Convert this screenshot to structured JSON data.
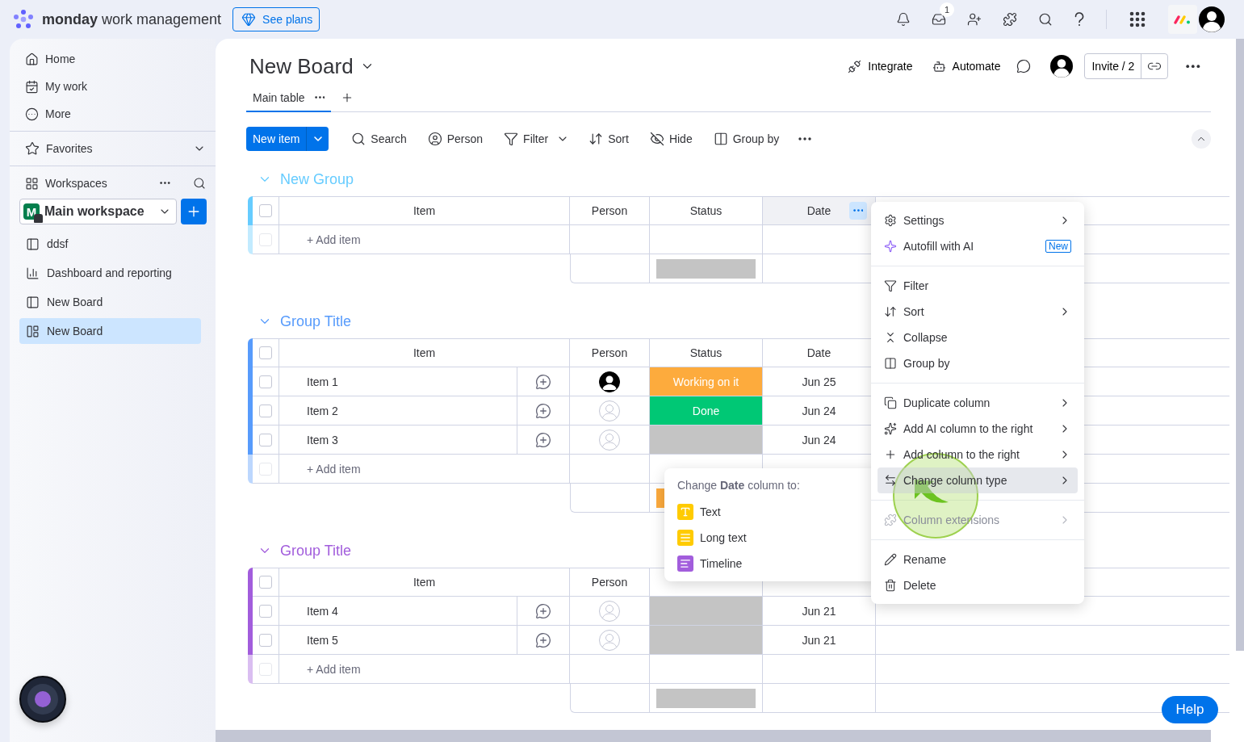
{
  "topbar": {
    "brand": "**monday** work management",
    "see_plans": "See plans",
    "inbox_badge": "1"
  },
  "sidebar": {
    "nav": [
      "Home",
      "My work",
      "More"
    ],
    "favorites": "Favorites",
    "workspaces": "Workspaces",
    "workspace": {
      "initial": "M",
      "name": "Main workspace"
    },
    "boards": [
      {
        "label": "ddsf",
        "kind": "board",
        "selected": false
      },
      {
        "label": "Dashboard and reporting",
        "kind": "dashboard",
        "selected": false
      },
      {
        "label": "New Board",
        "kind": "board",
        "selected": false
      },
      {
        "label": "New Board",
        "kind": "shared-board",
        "selected": true
      }
    ]
  },
  "board": {
    "title": "New Board",
    "actions": [
      "Integrate",
      "Automate"
    ],
    "invite": "Invite / 2",
    "views": [
      {
        "label": "Main table",
        "selected": true
      }
    ]
  },
  "toolbar": {
    "new_item": "New item",
    "tools": [
      "Search",
      "Person",
      "Filter",
      "Sort",
      "Hide",
      "Group by"
    ]
  },
  "groups": [
    {
      "title": "New Group",
      "color": "#66ccff",
      "header_checked": false,
      "columns": [
        {
          "label": "Item",
          "active": false
        },
        {
          "label": "Person",
          "active": false
        },
        {
          "label": "Status",
          "active": false
        },
        {
          "label": "Date",
          "active": true
        }
      ],
      "add_item": {
        "label": "+ Add item",
        "checked": false
      }
    },
    {
      "title": "Group Title",
      "color": "#579bfc",
      "header_checked": false,
      "columns": [
        {
          "label": "Item",
          "active": false
        },
        {
          "label": "Person",
          "active": false
        },
        {
          "label": "Status",
          "active": false
        },
        {
          "label": "Date",
          "active": false
        }
      ],
      "rows": [
        {
          "name": "Item 1",
          "checked": false,
          "assigned": true,
          "status": {
            "label": "Working on it",
            "color": "#fdab3d"
          },
          "date": "Jun 25"
        },
        {
          "name": "Item 2",
          "checked": false,
          "assigned": false,
          "status": {
            "label": "Done",
            "color": "#00c875"
          },
          "date": "Jun 24"
        },
        {
          "name": "Item 3",
          "checked": false,
          "assigned": false,
          "status": null,
          "date": "Jun 24"
        }
      ],
      "add_item": {
        "label": "+ Add item",
        "checked": false
      }
    },
    {
      "title": "Group Title",
      "color": "#a25ddc",
      "header_checked": false,
      "columns": [
        {
          "label": "Item",
          "active": false
        },
        {
          "label": "Person",
          "active": false
        }
      ],
      "rows": [
        {
          "name": "Item 4",
          "checked": false,
          "assigned": false,
          "status": null,
          "date": "Jun 21"
        },
        {
          "name": "Item 5",
          "checked": false,
          "assigned": false,
          "status": null,
          "date": "Jun 21"
        }
      ],
      "add_item": {
        "label": "+ Add item",
        "checked": false
      }
    }
  ],
  "column_menu": {
    "sections": [
      [
        {
          "label": "Settings",
          "submenu": true,
          "disabled": false,
          "selected": false
        },
        {
          "label": "Autofill with AI",
          "submenu": false,
          "disabled": false,
          "selected": false,
          "badge": "New"
        }
      ],
      [
        {
          "label": "Filter",
          "submenu": false,
          "disabled": false,
          "selected": false
        },
        {
          "label": "Sort",
          "submenu": true,
          "disabled": false,
          "selected": false
        },
        {
          "label": "Collapse",
          "submenu": false,
          "disabled": false,
          "selected": false
        },
        {
          "label": "Group by",
          "submenu": false,
          "disabled": false,
          "selected": false
        }
      ],
      [
        {
          "label": "Duplicate column",
          "submenu": true,
          "disabled": false,
          "selected": false
        },
        {
          "label": "Add AI column to the right",
          "submenu": true,
          "disabled": false,
          "selected": false
        },
        {
          "label": "Add column to the right",
          "submenu": true,
          "disabled": false,
          "selected": false
        },
        {
          "label": "Change column type",
          "submenu": true,
          "disabled": false,
          "selected": true
        }
      ],
      [
        {
          "label": "Column extensions",
          "submenu": true,
          "disabled": true,
          "selected": false
        }
      ],
      [
        {
          "label": "Rename",
          "submenu": false,
          "disabled": false,
          "selected": false
        },
        {
          "label": "Delete",
          "submenu": false,
          "disabled": false,
          "selected": false
        }
      ]
    ]
  },
  "type_submenu": {
    "heading": "Change **Date** column to:",
    "options": [
      {
        "label": "Text",
        "color": "#ffcb00"
      },
      {
        "label": "Long text",
        "color": "#ffcb00"
      },
      {
        "label": "Timeline",
        "color": "#a25ddc"
      }
    ]
  },
  "help": "Help"
}
